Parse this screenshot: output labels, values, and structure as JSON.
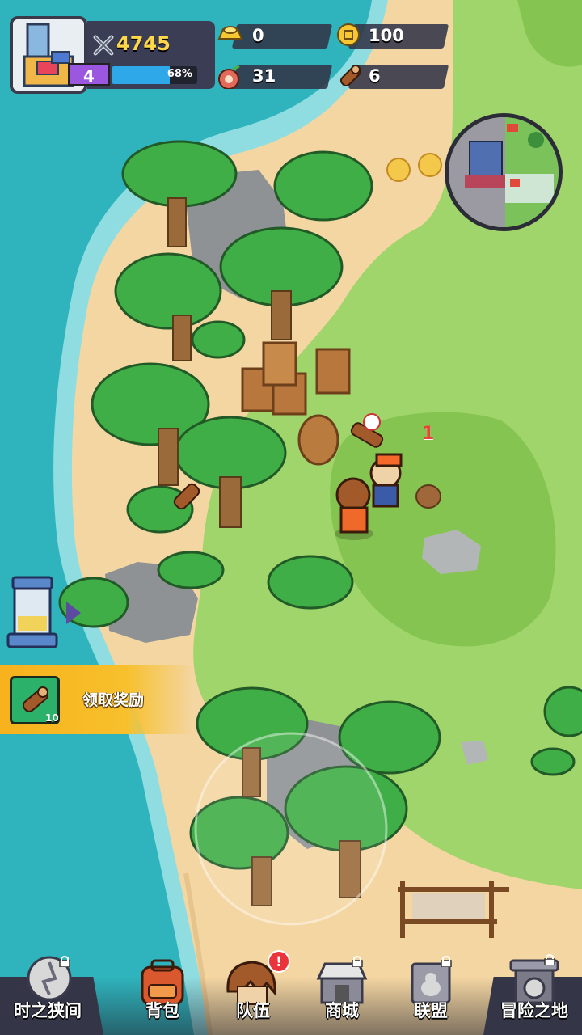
{
  "hud": {
    "power": "4745",
    "level": "4",
    "xp_percent": "68%",
    "xp_fraction": 0.68,
    "resources": [
      {
        "icon": "gold-ingot-icon",
        "value": "0"
      },
      {
        "icon": "coin-icon",
        "value": "100"
      },
      {
        "icon": "meat-icon",
        "value": "31"
      },
      {
        "icon": "wood-log-icon",
        "value": "6"
      }
    ]
  },
  "floating_number": "1",
  "reward": {
    "label": "领取奖励",
    "item_icon": "wood-log-icon",
    "count": "10"
  },
  "nav": {
    "items": [
      {
        "label": "时之狭间",
        "icon": "time-rift-icon",
        "locked": true
      },
      {
        "label": "背包",
        "icon": "backpack-icon",
        "locked": false
      },
      {
        "label": "队伍",
        "icon": "team-hero-icon",
        "locked": false,
        "alert": "!"
      },
      {
        "label": "商城",
        "icon": "shop-icon",
        "locked": true
      },
      {
        "label": "联盟",
        "icon": "alliance-icon",
        "locked": true
      },
      {
        "label": "冒险之地",
        "icon": "adventure-gate-icon",
        "locked": true
      }
    ]
  },
  "colors": {
    "sea": "#2fb4bd",
    "sand": "#f4d6a2",
    "grass": "#9fd56a",
    "hud_panel": "#3b3d55",
    "gold_text": "#ffd84a",
    "level_purple": "#9b57e0",
    "xp_blue": "#2ea8e8",
    "reward_yellow": "#f7b21d"
  }
}
